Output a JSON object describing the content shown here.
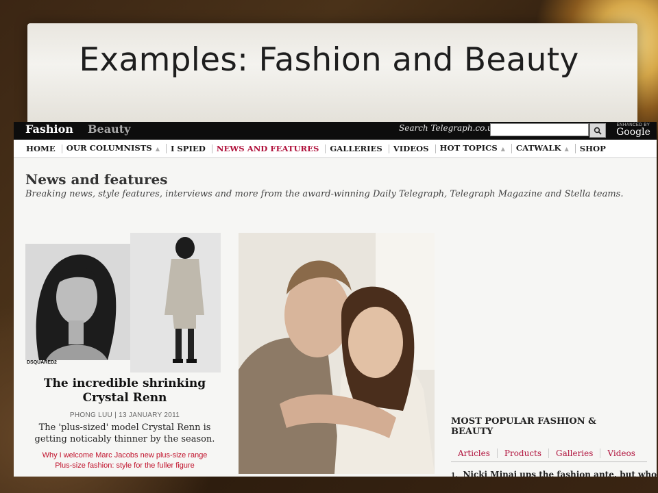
{
  "slide": {
    "title": "Examples: Fashion and Beauty"
  },
  "header": {
    "brand_fashion": "Fashion",
    "brand_beauty": "Beauty",
    "search_label": "Search Telegraph.co.uk",
    "search_value": "",
    "google_enhanced": "ENHANCED BY",
    "google": "Google"
  },
  "nav": {
    "items": [
      {
        "label": "HOME",
        "dropdown": false
      },
      {
        "label": "OUR COLUMNISTS",
        "dropdown": true
      },
      {
        "label": "I SPIED",
        "dropdown": false
      },
      {
        "label": "NEWS AND FEATURES",
        "dropdown": false,
        "active": true
      },
      {
        "label": "GALLERIES",
        "dropdown": false
      },
      {
        "label": "VIDEOS",
        "dropdown": false
      },
      {
        "label": "HOT TOPICS",
        "dropdown": true
      },
      {
        "label": "CATWALK",
        "dropdown": true
      },
      {
        "label": "SHOP",
        "dropdown": false
      }
    ]
  },
  "main": {
    "section_title": "News and features",
    "section_subtitle": "Breaking news, style features, interviews and more from the award-winning Daily Telegraph, Telegraph Magazine and Stella teams.",
    "story": {
      "image_caption": "DSQUARED2",
      "headline": "The incredible shrinking Crystal Renn",
      "byline": "PHONG LUU | 13 JANUARY 2011",
      "summary": "The 'plus-sized' model Crystal Renn is getting noticably thinner by the season.",
      "links": [
        "Why I welcome Marc Jacobs new plus-size range",
        "Plus-size fashion: style for the fuller figure"
      ]
    },
    "most_popular": {
      "title": "MOST POPULAR FASHION & BEAUTY",
      "tabs": [
        "Articles",
        "Products",
        "Galleries",
        "Videos"
      ],
      "items": [
        {
          "num": "1.",
          "text": "Nicki Minaj ups the fashion ante, but who on"
        }
      ]
    }
  },
  "colors": {
    "accent_red": "#b0123c",
    "topbar": "#0d0d0d"
  }
}
